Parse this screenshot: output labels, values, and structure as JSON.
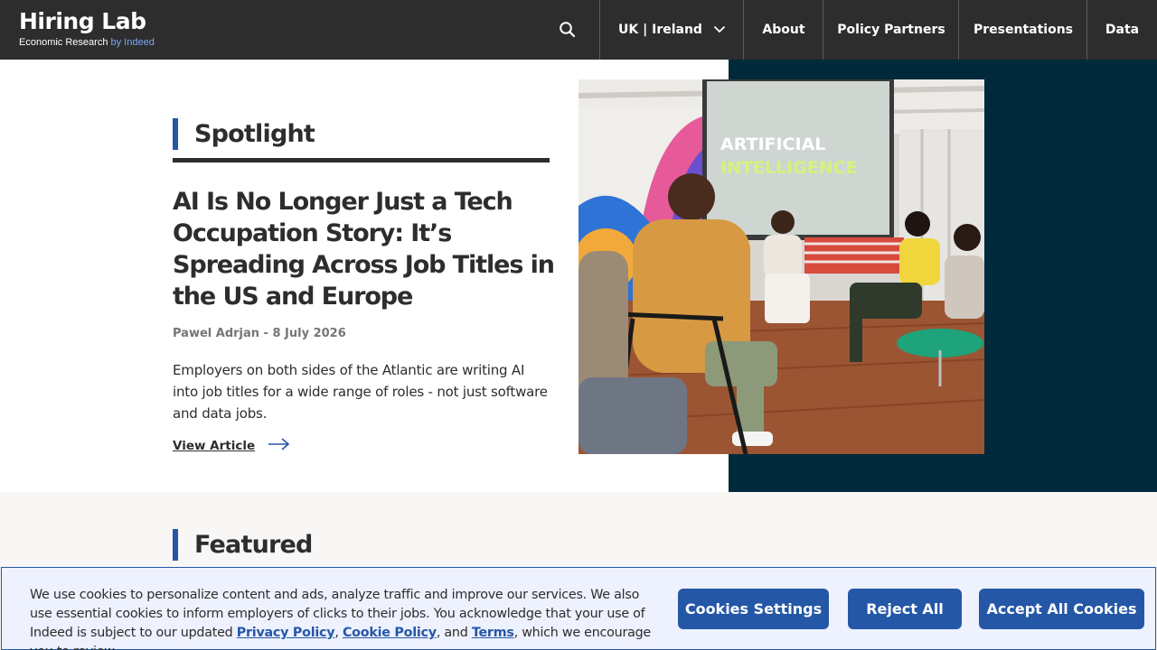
{
  "header": {
    "logo_title": "Hiring Lab",
    "logo_subtitle_prefix": "Economic Research ",
    "logo_subtitle_suffix": "by Indeed",
    "region_label": "UK | Ireland",
    "nav": [
      {
        "label": "About"
      },
      {
        "label": "Policy Partners"
      },
      {
        "label": "Presentations"
      },
      {
        "label": "Data"
      }
    ],
    "icons": {
      "search": "search-icon",
      "region_dropdown": "chevron-down-icon"
    }
  },
  "spotlight": {
    "heading": "Spotlight",
    "article": {
      "title": "AI Is No Longer Just a Tech Occupation Story: It’s Spreading Across Job Titles in the US and Europe",
      "meta": "Pawel Adrjan - 8 July 2026",
      "summary": "Employers on both sides of the Atlantic are writing AI into job titles for a wide range of roles - not just software and data jobs.",
      "cta_label": "View Article",
      "image": {
        "slide_line1": "ARTIFICIAL",
        "slide_line2": "INTELLIGENCE"
      }
    }
  },
  "featured": {
    "heading": "Featured"
  },
  "cookie_banner": {
    "text_1": "We use cookies to personalize content and ads, analyze traffic and improve our services. We also use essential cookies to inform employers of clicks to their jobs. You acknowledge that your use of Indeed is subject to our updated ",
    "privacy_link": "Privacy Policy",
    "sep_1": ", ",
    "cookie_link": "Cookie Policy",
    "sep_2": ", and ",
    "terms_link": "Terms",
    "text_2": ", which we encourage you to review.",
    "settings_label": "Cookies Settings",
    "reject_label": "Reject All",
    "accept_label": "Accept All Cookies"
  },
  "colors": {
    "header_bg": "#2d2d2d",
    "accent_blue": "#2557a7",
    "dark_panel": "#00293b",
    "cookie_bg": "#eef1fe",
    "featured_bg": "#f8f7f6"
  }
}
